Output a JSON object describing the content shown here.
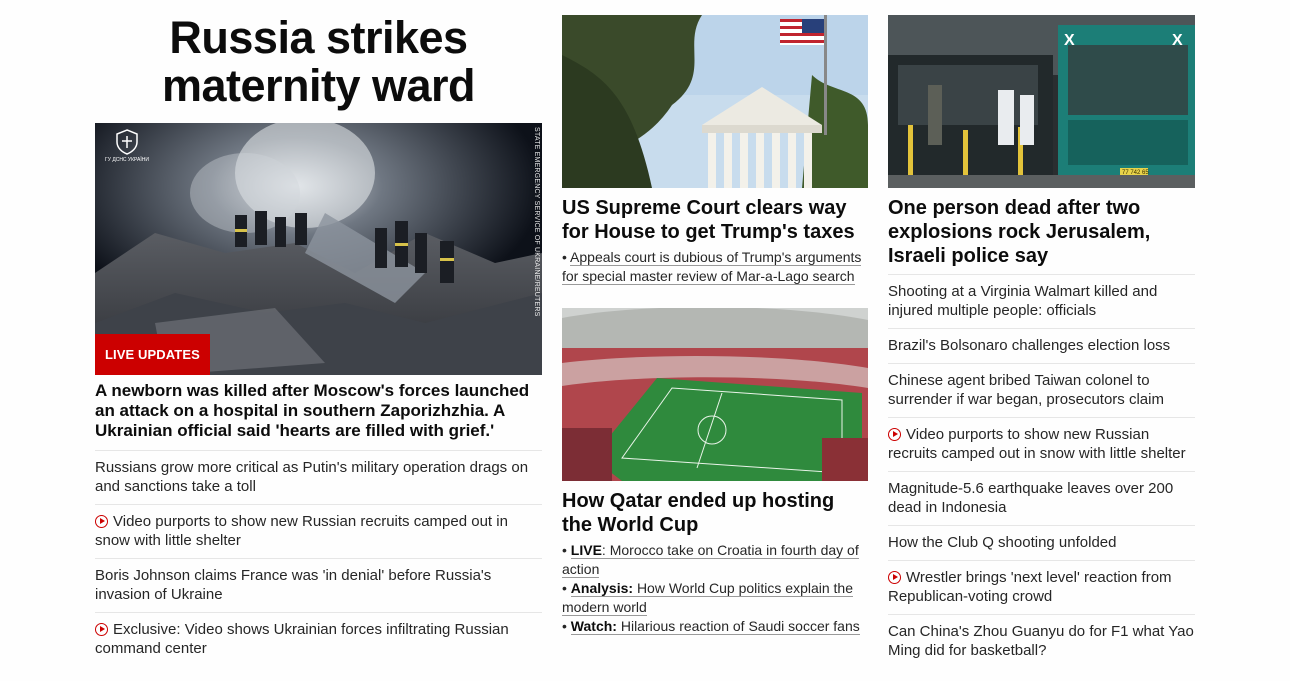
{
  "lead": {
    "headline": "Russia strikes maternity ward",
    "badge": "LIVE UPDATES",
    "photo_credit": "STATE EMERGENCY SERVICE OF UKRAINE/REUTERS",
    "logo_text": "ГУ ДСНС УКРАЇНИ",
    "description": "A newborn was killed after Moscow's forces launched an attack on a hospital in southern Zaporizhzhia. A Ukrainian official said 'hearts are filled with grief.'",
    "related": [
      {
        "text": "Russians grow more critical as Putin's military operation drags on and sanctions take a toll",
        "video": false
      },
      {
        "text": "Video purports to show new Russian recruits camped out in snow with little shelter",
        "video": true
      },
      {
        "text": "Boris Johnson claims France was 'in denial' before Russia's invasion of Ukraine",
        "video": false
      },
      {
        "text": "Exclusive: Video shows Ukrainian forces infiltrating Russian command center",
        "video": true
      }
    ]
  },
  "middle": {
    "story1": {
      "headline": "US Supreme Court clears way for House to get Trump's taxes",
      "sub": "Appeals court is dubious of Trump's arguments for special master review of Mar-a-Lago search"
    },
    "story2": {
      "headline": "How Qatar ended up hosting the World Cup",
      "subs": [
        {
          "label": "LIVE",
          "sep": ": ",
          "text": "Morocco take on Croatia in fourth day of action"
        },
        {
          "label": "Analysis:",
          "sep": " ",
          "text": "How World Cup politics explain the modern world"
        },
        {
          "label": "Watch:",
          "sep": " ",
          "text": "Hilarious reaction of Saudi soccer fans"
        }
      ]
    }
  },
  "right": {
    "headline": "One person dead after two explosions rock Jerusalem, Israeli police say",
    "bus_sign": "77 742 65",
    "items": [
      {
        "text": "Shooting at a Virginia Walmart killed and injured multiple people: officials",
        "video": false
      },
      {
        "text": "Brazil's Bolsonaro challenges election loss",
        "video": false
      },
      {
        "text": "Chinese agent bribed Taiwan colonel to surrender if war began, prosecutors claim",
        "video": false
      },
      {
        "text": "Video purports to show new Russian recruits camped out in snow with little shelter",
        "video": true
      },
      {
        "text": "Magnitude-5.6 earthquake leaves over 200 dead in Indonesia",
        "video": false
      },
      {
        "text": "How the Club Q shooting unfolded",
        "video": false
      },
      {
        "text": "Wrestler brings 'next level' reaction from Republican-voting crowd",
        "video": true
      },
      {
        "text": "Can China's Zhou Guanyu do for F1 what Yao Ming did for basketball?",
        "video": false
      }
    ]
  }
}
